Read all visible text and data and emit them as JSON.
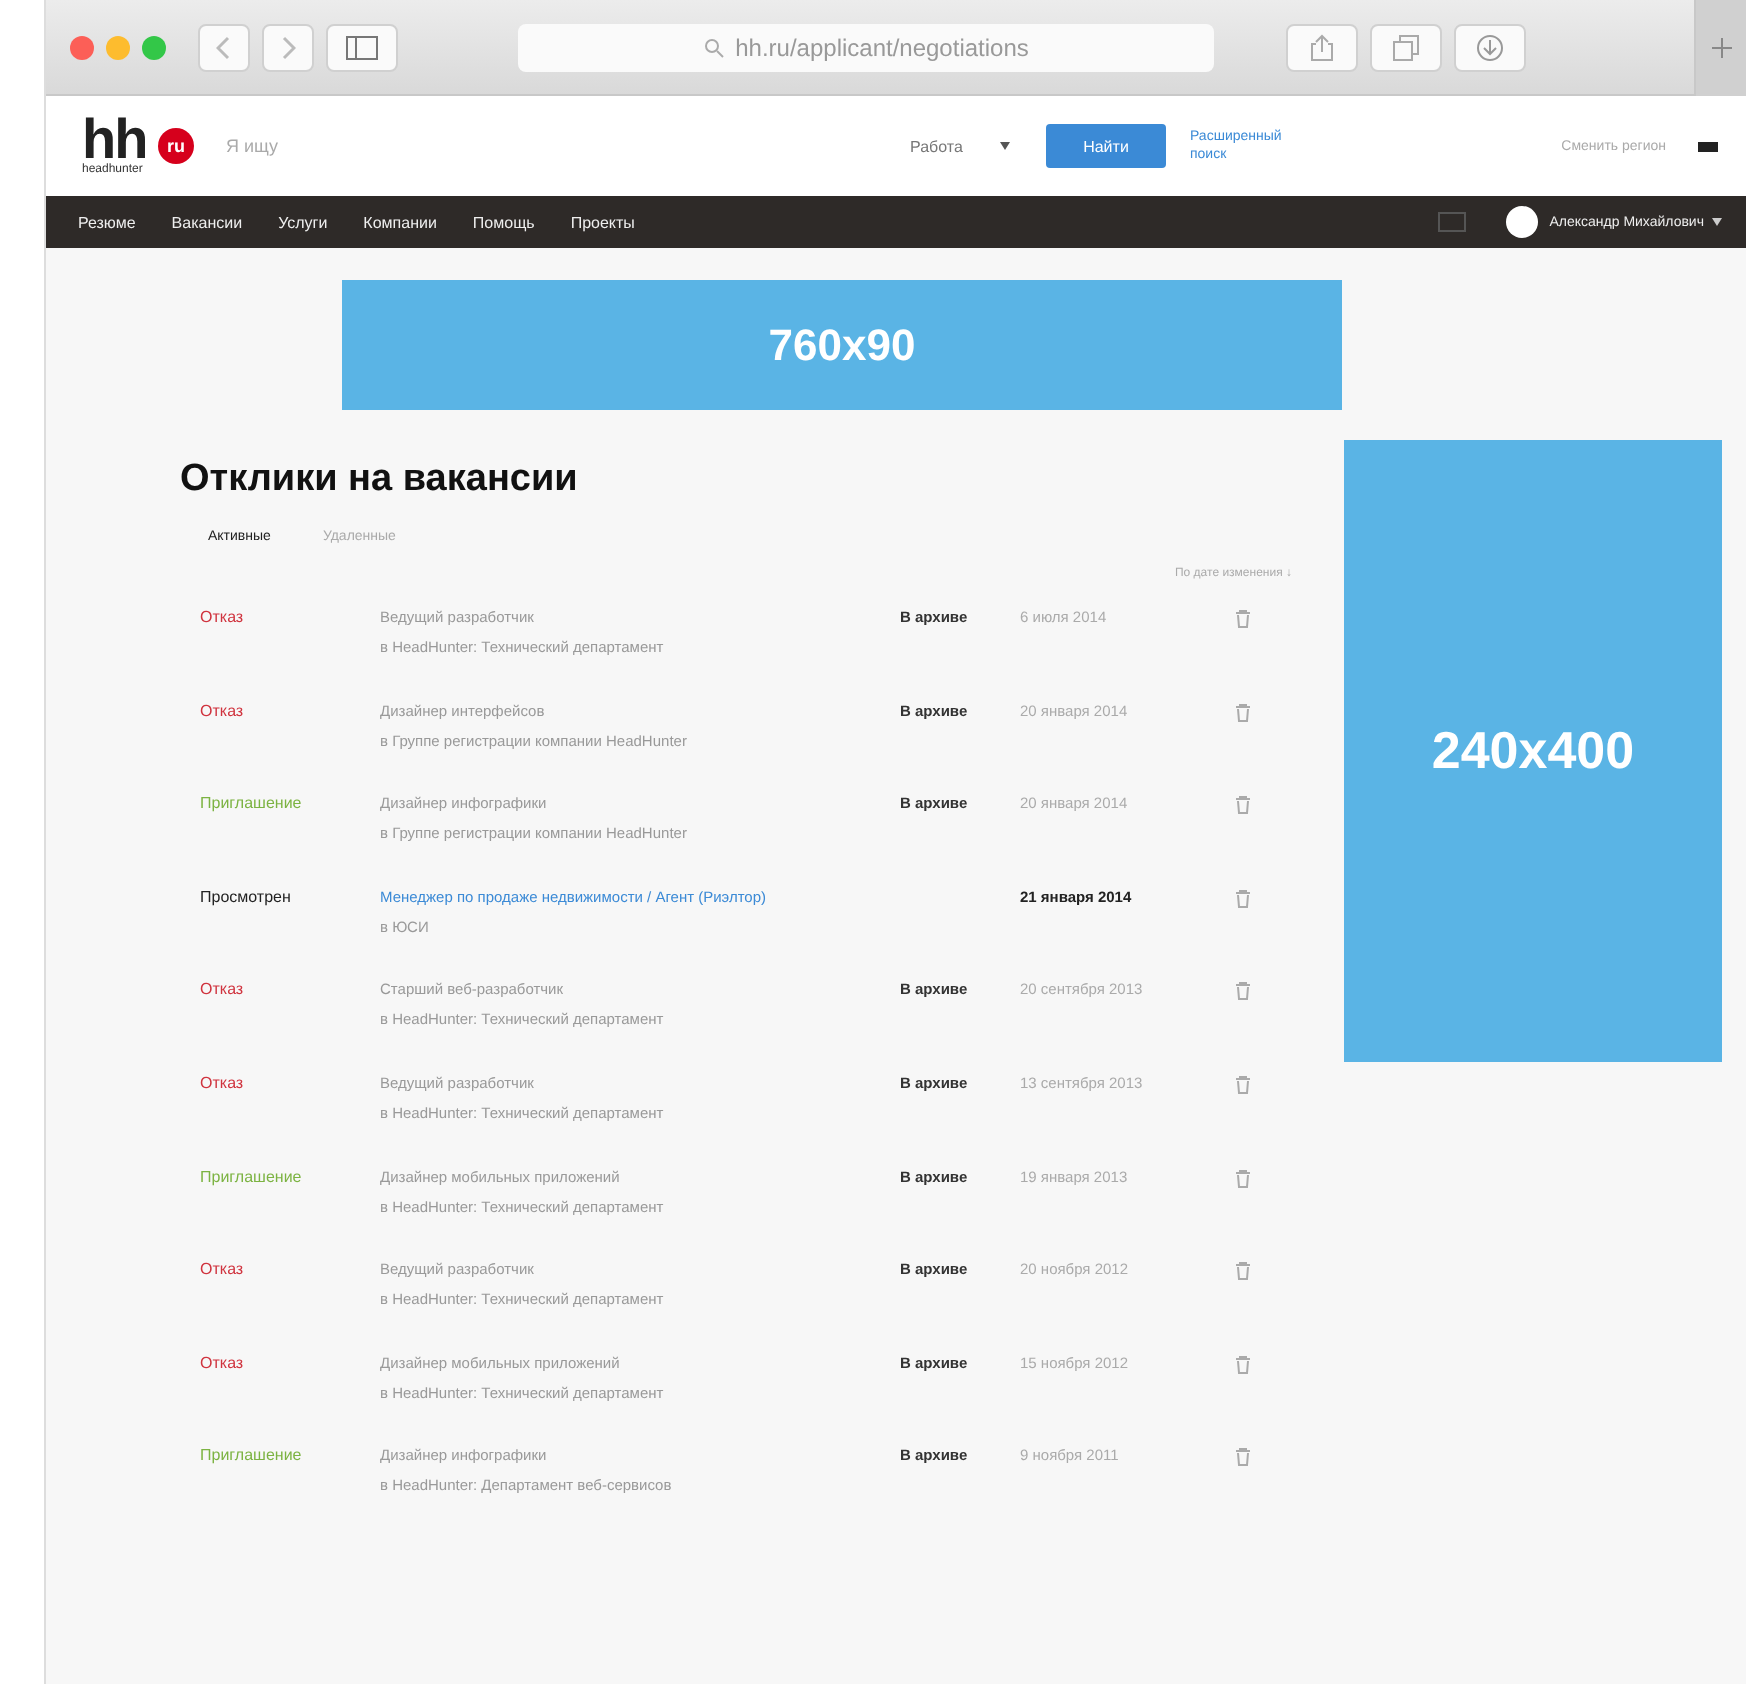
{
  "browser": {
    "address": "hh.ru/applicant/negotiations"
  },
  "header": {
    "logo": "hh",
    "logo_badge": "ru",
    "logo_caption": "headhunter",
    "search_placeholder": "Я ищу",
    "select": "Работа",
    "search_button": "Найти",
    "advanced_link": "Расширенный поиск",
    "region": "Сменить регион"
  },
  "nav": {
    "items": [
      "Резюме",
      "Вакансии",
      "Услуги",
      "Компании",
      "Помощь",
      "Проекты"
    ],
    "user": "Александр Михайлович"
  },
  "ads": [
    "760x90",
    "240x400"
  ],
  "page": {
    "title": "Отклики на вакансии",
    "tabs": [
      {
        "label": "Активные",
        "selected": true
      },
      {
        "label": "Удаленные",
        "selected": false
      }
    ],
    "sort": "По дате изменения ↓",
    "rows": [
      {
        "status": "Отказ",
        "kind": "reject",
        "title": "Ведущий разработчик",
        "company": "в HeadHunter: Технический департамент",
        "archived": true,
        "archive_label": "В архиве",
        "date": "6 июля 2014"
      },
      {
        "status": "Отказ",
        "kind": "reject",
        "title": "Дизайнер интерфейсов",
        "company": "в Группе регистрации компании HeadHunter",
        "archived": true,
        "archive_label": "В архиве",
        "date": "20 января 2014"
      },
      {
        "status": "Приглашение",
        "kind": "invite",
        "title": "Дизайнер инфографики",
        "company": "в Группе регистрации компании HeadHunter",
        "archived": true,
        "archive_label": "В архиве",
        "date": "20 января 2014"
      },
      {
        "status": "Просмотрен",
        "kind": "viewed",
        "title": "Менеджер по продаже недвижимости / Агент (Риэлтор)",
        "company": "в ЮСИ",
        "archived": false,
        "date": "21 января 2014"
      },
      {
        "status": "Отказ",
        "kind": "reject",
        "title": "Старший веб-разработчик",
        "company": "в HeadHunter: Технический департамент",
        "archived": true,
        "archive_label": "В архиве",
        "date": "20 сентября 2013"
      },
      {
        "status": "Отказ",
        "kind": "reject",
        "title": "Ведущий разработчик",
        "company": "в HeadHunter: Технический департамент",
        "archived": true,
        "archive_label": "В архиве",
        "date": "13 сентября 2013"
      },
      {
        "status": "Приглашение",
        "kind": "invite",
        "title": "Дизайнер мобильных приложений",
        "company": "в HeadHunter: Технический департамент",
        "archived": true,
        "archive_label": "В архиве",
        "date": "19 января 2013"
      },
      {
        "status": "Отказ",
        "kind": "reject",
        "title": "Ведущий разработчик",
        "company": "в HeadHunter: Технический департамент",
        "archived": true,
        "archive_label": "В архиве",
        "date": "20 ноября 2012"
      },
      {
        "status": "Отказ",
        "kind": "reject",
        "title": "Дизайнер мобильных приложений",
        "company": "в HeadHunter: Технический департамент",
        "archived": true,
        "archive_label": "В архиве",
        "date": "15 ноября 2012"
      },
      {
        "status": "Приглашение",
        "kind": "invite",
        "title": "Дизайнер инфографики",
        "company": "в HeadHunter: Департамент веб-сервисов",
        "archived": true,
        "archive_label": "В архиве",
        "date": "9 ноября 2011"
      }
    ]
  }
}
